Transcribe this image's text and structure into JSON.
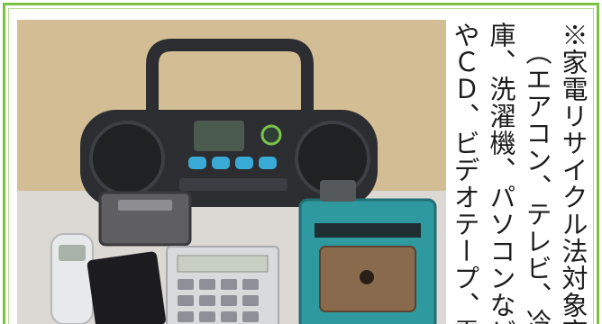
{
  "notice": {
    "lines": [
      "※家電リサイクル法対象商品",
      "（エアコン、テレビ、冷蔵",
      "庫、洗濯機、パソコンなど）",
      "やＣＤ、ビデオテープ、電"
    ]
  },
  "photo": {
    "subject": "small household electronics",
    "items": [
      "boombox",
      "calculator",
      "pencil-sharpener",
      "cordless-phone",
      "digital-camera",
      "portable-device"
    ]
  },
  "colors": {
    "frame": "#7cc242",
    "text": "#1d1d1d",
    "boombox": "#2b2d30",
    "sharpener": "#2e9aa0"
  }
}
